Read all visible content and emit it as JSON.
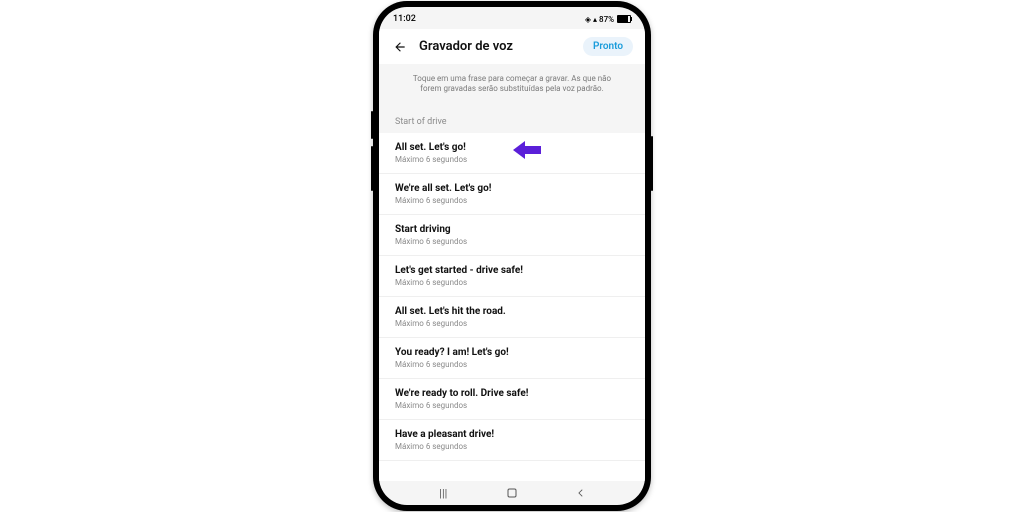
{
  "status": {
    "time": "11:02",
    "battery": "87%"
  },
  "header": {
    "title": "Gravador de voz",
    "done": "Pronto"
  },
  "hint": "Toque em uma frase para começar a gravar. As que não forem gravadas serão substituídas pela voz padrão.",
  "section": "Start of drive",
  "phrases": [
    {
      "title": "All set. Let's go!",
      "sub": "Máximo 6 segundos",
      "arrow": true
    },
    {
      "title": "We're all set. Let's go!",
      "sub": "Máximo 6 segundos"
    },
    {
      "title": "Start driving",
      "sub": "Máximo 6 segundos"
    },
    {
      "title": "Let's get started - drive safe!",
      "sub": "Máximo 6 segundos"
    },
    {
      "title": "All set. Let's hit the road.",
      "sub": "Máximo 6 segundos"
    },
    {
      "title": "You ready? I am! Let's go!",
      "sub": "Máximo 6 segundos"
    },
    {
      "title": "We're ready to roll. Drive safe!",
      "sub": "Máximo 6 segundos"
    },
    {
      "title": "Have a pleasant drive!",
      "sub": "Máximo 6 segundos"
    }
  ],
  "arrowColor": "#5b1fd9"
}
